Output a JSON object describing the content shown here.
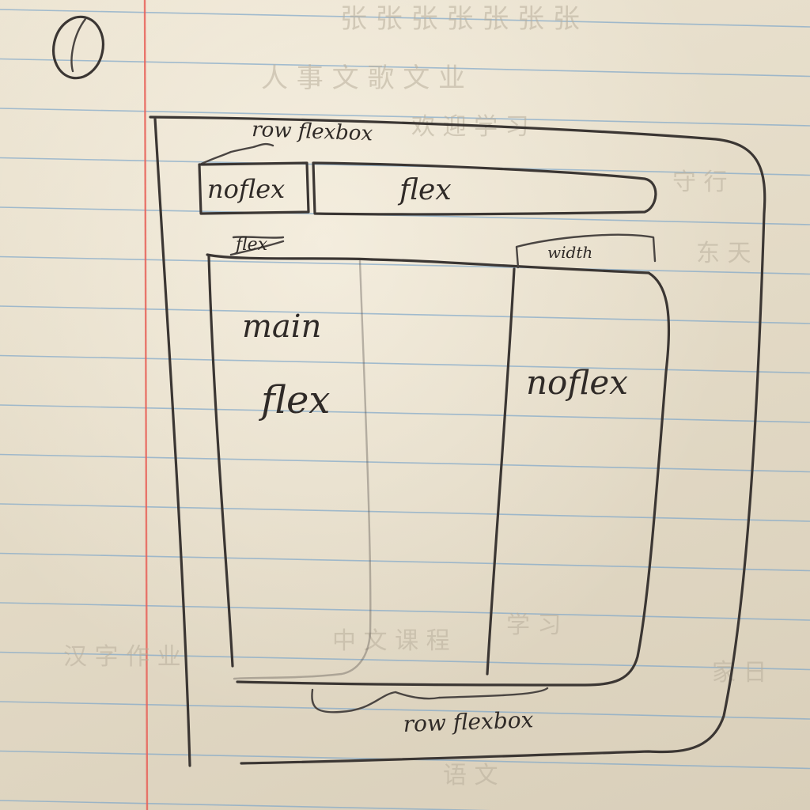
{
  "paper": {
    "rule_color": "#7fa6c9",
    "margin_color": "#e8635a",
    "pencil_color": "#3b3633"
  },
  "labels": {
    "corner_mark": "0",
    "top_brace": "row flexbox",
    "header_left": "noflex",
    "header_right": "flex",
    "struck_word": "flex",
    "side_tab": "width",
    "main_line1": "main",
    "main_line2": "flex",
    "right_col": "noflex",
    "bottom_brace": "row flexbox"
  }
}
